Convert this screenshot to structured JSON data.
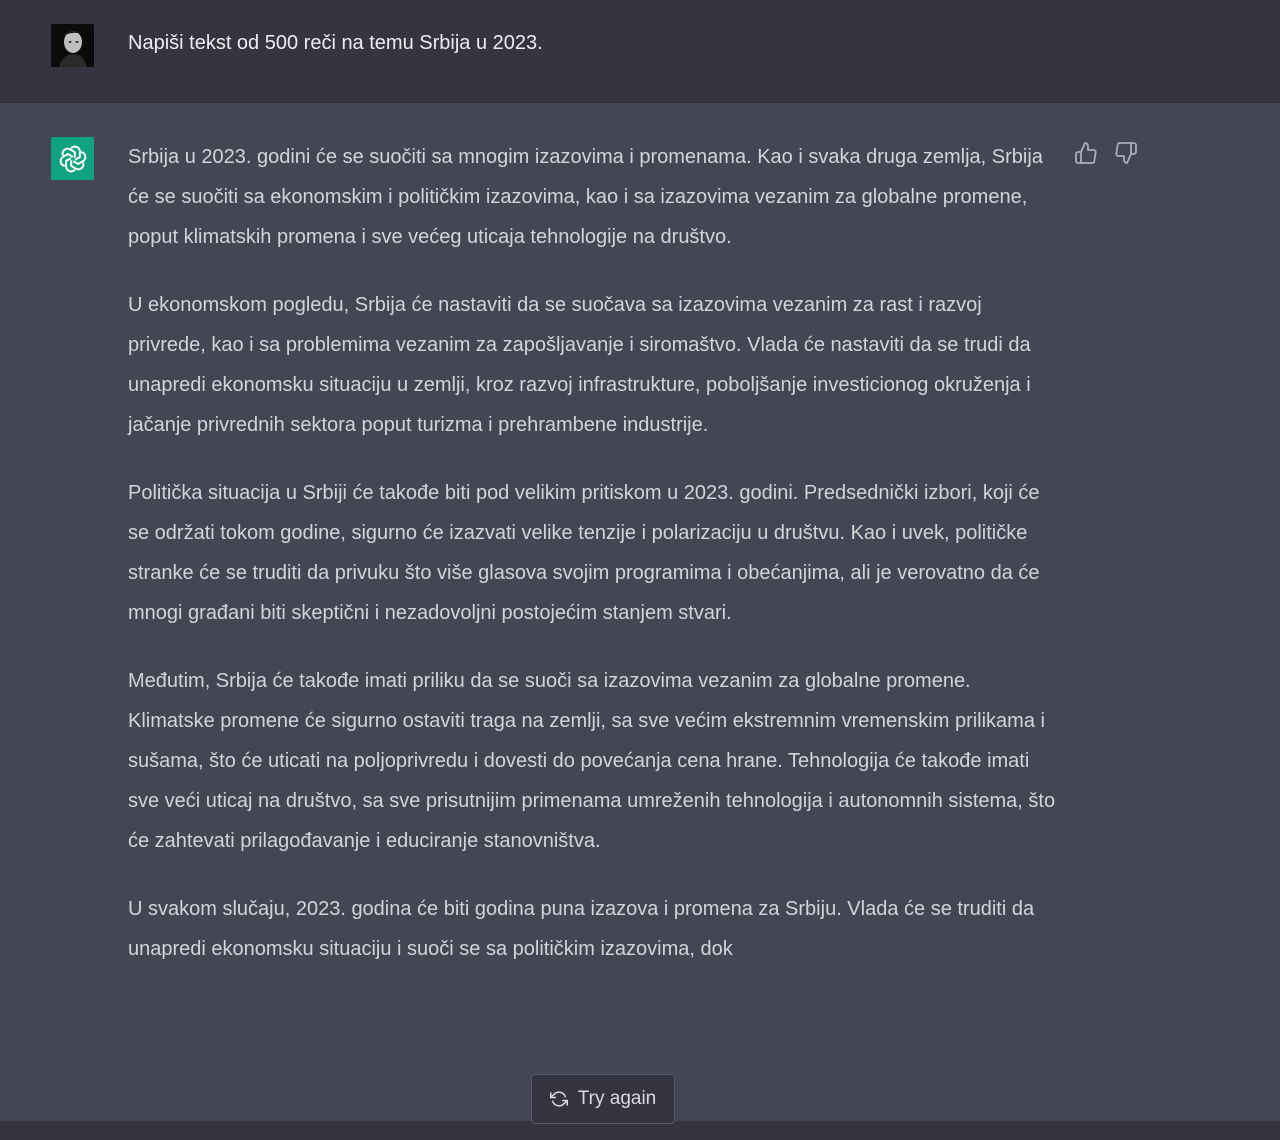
{
  "conversation": {
    "user_message": "Napiši tekst od 500 reči na temu Srbija u 2023.",
    "assistant_paragraphs": [
      "Srbija u 2023. godini će se suočiti sa mnogim izazovima i promenama. Kao i svaka druga zemlja, Srbija će se suočiti sa ekonomskim i političkim izazovima, kao i sa izazovima vezanim za globalne promene, poput klimatskih promena i sve većeg uticaja tehnologije na društvo.",
      "U ekonomskom pogledu, Srbija će nastaviti da se suočava sa izazovima vezanim za rast i razvoj privrede, kao i sa problemima vezanim za zapošljavanje i siromaštvo. Vlada će nastaviti da se trudi da unapredi ekonomsku situaciju u zemlji, kroz razvoj infrastrukture, poboljšanje investicionog okruženja i jačanje privrednih sektora poput turizma i prehrambene industrije.",
      "Politička situacija u Srbiji će takođe biti pod velikim pritiskom u 2023. godini. Predsednički izbori, koji će se održati tokom godine, sigurno će izazvati velike tenzije i polarizaciju u društvu. Kao i uvek, političke stranke će se truditi da privuku što više glasova svojim programima i obećanjima, ali je verovatno da će mnogi građani biti skeptični i nezadovoljni postojećim stanjem stvari.",
      "Međutim, Srbija će takođe imati priliku da se suoči sa izazovima vezanim za globalne promene. Klimatske promene će sigurno ostaviti traga na zemlji, sa sve većim ekstremnim vremenskim prilikama i sušama, što će uticati na poljoprivredu i dovesti do povećanja cena hrane. Tehnologija će takođe imati sve veći uticaj na društvo, sa sve prisutnijim primenama umreženih tehnologija i autonomnih sistema, što će zahtevati prilagođavanje i educiranje stanovništva.",
      "U svakom slučaju, 2023. godina će biti godina puna izazova i promena za Srbiju. Vlada će se truditi da unapredi ekonomsku situaciju i suoči se sa političkim izazovima, dok"
    ]
  },
  "actions": {
    "try_again_label": "Try again",
    "thumbs_up_icon": "thumbs-up-icon",
    "thumbs_down_icon": "thumbs-down-icon",
    "refresh_icon": "refresh-icon"
  },
  "colors": {
    "user_bg": "#343541",
    "assistant_bg": "#444654",
    "gpt_logo_bg": "#10a37f",
    "text": "#d1d5db"
  }
}
